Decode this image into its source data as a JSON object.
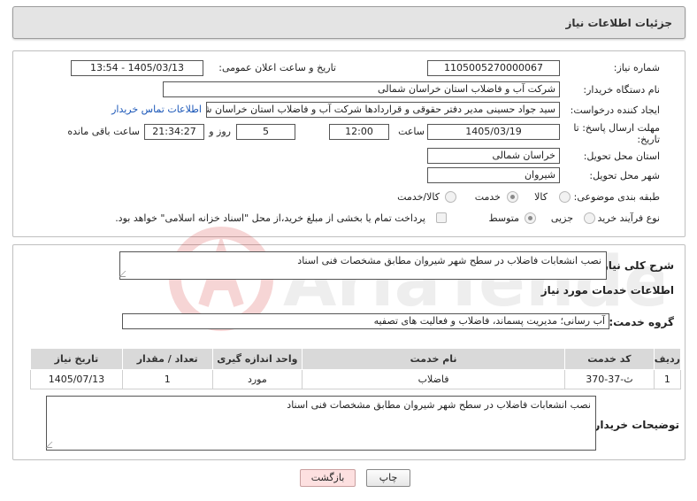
{
  "header": {
    "title": "جزئیات اطلاعات نیاز"
  },
  "form": {
    "need_number_label": "شماره نیاز:",
    "need_number": "1105005270000067",
    "announce_label": "تاریخ و ساعت اعلان عمومی:",
    "announce_value": "1405/03/13 - 13:54",
    "buyer_org_label": "نام دستگاه خریدار:",
    "buyer_org": "شرکت آب و فاضلاب استان خراسان شمالی",
    "creator_label": "ایجاد کننده درخواست:",
    "creator": "سید جواد حسینی مدیر دفتر حقوقی و قراردادها  شرکت آب و فاضلاب استان خراسان شمالی",
    "contact_link": "اطلاعات تماس خریدار",
    "deadline_label_1": "مهلت ارسال پاسخ: تا",
    "deadline_label_2": "تاریخ:",
    "deadline_date": "1405/03/19",
    "time_label": "ساعت",
    "deadline_time": "12:00",
    "days_value": "5",
    "days_label": "روز و",
    "remaining_time": "21:34:27",
    "remaining_label": "ساعت باقی مانده",
    "province_label": "استان محل تحویل:",
    "province": "خراسان شمالی",
    "city_label": "شهر محل تحویل:",
    "city": "شیروان",
    "category_label": "طبقه بندی موضوعی:",
    "category_options": [
      "کالا",
      "خدمت",
      "کالا/خدمت"
    ],
    "category_selected": "خدمت",
    "process_label": "نوع فرآیند خرید :",
    "process_options": [
      "جزیی",
      "متوسط"
    ],
    "process_selected": "متوسط",
    "treasury_note": "پرداخت تمام یا بخشی از مبلغ خرید،از محل \"اسناد خزانه اسلامی\" خواهد بود."
  },
  "summary": {
    "label": "شرح کلی نیاز:",
    "text": "نصب انشعابات فاضلاب در سطح شهر شیروان مطابق مشخصات فنی اسناد",
    "services_heading": "اطلاعات خدمات مورد نیاز",
    "service_group_label": "گروه خدمت:",
    "service_group": "آب رسانی؛ مدیریت پسماند، فاضلاب و فعالیت های تصفیه"
  },
  "table": {
    "headers": [
      "ردیف",
      "کد خدمت",
      "نام خدمت",
      "واحد اندازه گیری",
      "تعداد / مقدار",
      "تاریخ نیاز"
    ],
    "rows": [
      [
        "1",
        "ث-37-370",
        "فاضلاب",
        "مورد",
        "1",
        "1405/07/13"
      ]
    ]
  },
  "buyer_notes": {
    "label": "توضیحات خریدار:",
    "text": "نصب انشعابات فاضلاب در سطح شهر شیروان مطابق مشخصات فنی اسناد"
  },
  "buttons": {
    "print": "چاپ",
    "back": "بازگشت"
  },
  "watermark": {
    "text": "AriaTender.neT"
  }
}
